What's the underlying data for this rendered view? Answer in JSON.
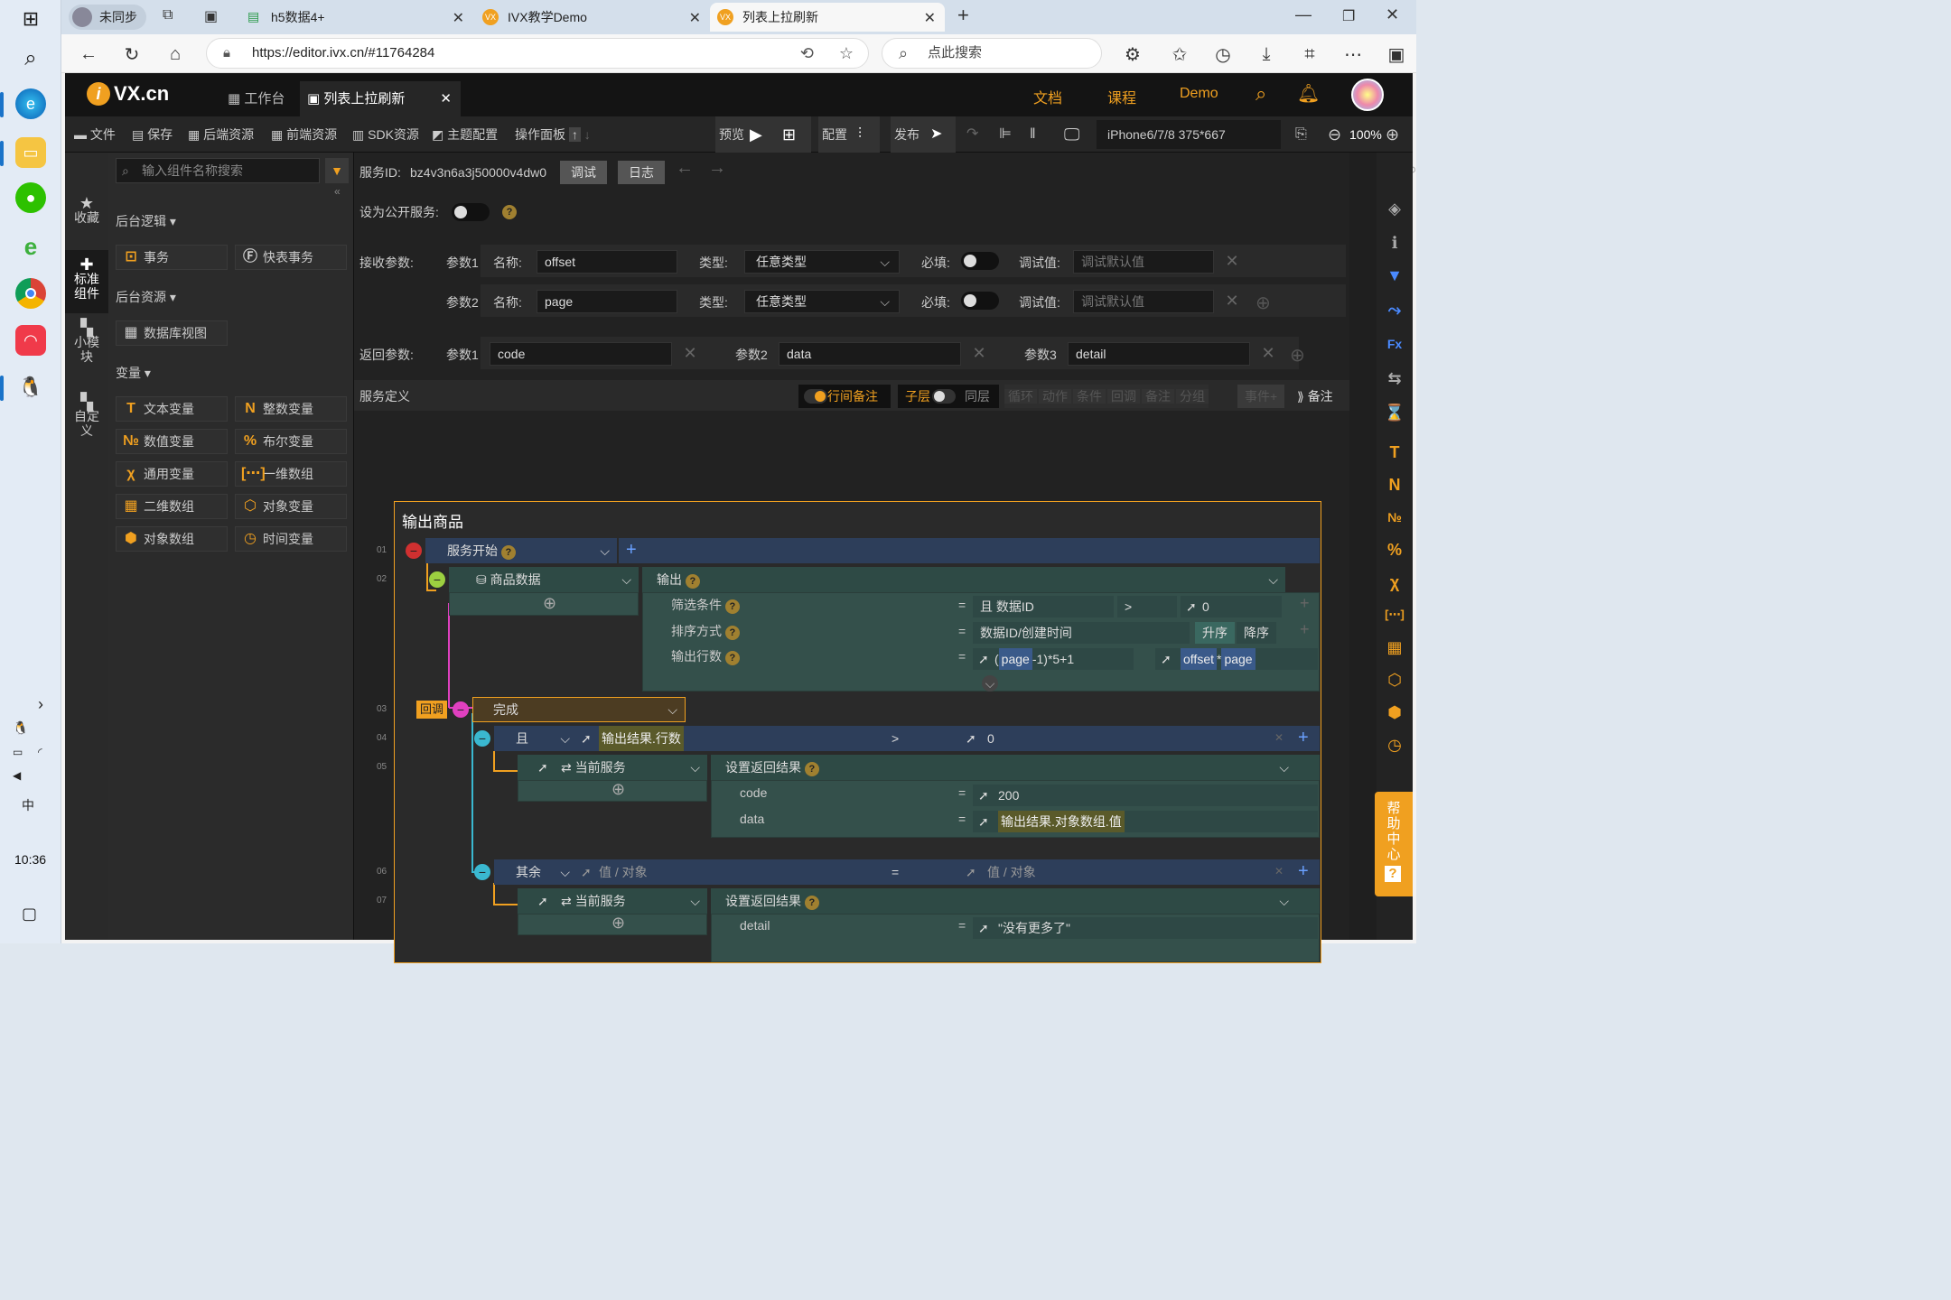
{
  "taskbar": {
    "clock": "10:36",
    "icons": [
      "windows-logo-icon",
      "search-icon",
      "edge-icon",
      "file-explorer-icon",
      "wechat-icon",
      "ie-icon",
      "chrome-icon",
      "app-icon",
      "qq-icon"
    ]
  },
  "browser": {
    "profile_label": "未同步",
    "tabs": [
      {
        "label": "h5数据4+"
      },
      {
        "label": "IVX教学Demo"
      },
      {
        "label": "列表上拉刷新"
      }
    ],
    "url": "https://editor.ivx.cn/#11764284",
    "search_placeholder": "点此搜索"
  },
  "app": {
    "logo": "VX.cn",
    "tabs": [
      {
        "label": "工作台"
      },
      {
        "label": "列表上拉刷新"
      }
    ],
    "header_links": [
      "文档",
      "课程",
      "Demo"
    ],
    "toolbar": {
      "file": "文件",
      "save": "保存",
      "backend_res": "后端资源",
      "frontend_res": "前端资源",
      "sdk_res": "SDK资源",
      "theme": "主题配置",
      "ops_panel": "操作面板",
      "preview": "预览",
      "config": "配置",
      "publish": "发布",
      "device": "iPhone6/7/8 375*667",
      "zoom": "100%"
    },
    "left_rail": [
      {
        "label": "收藏"
      },
      {
        "label": "标准组件"
      },
      {
        "label": "小模块"
      },
      {
        "label": "自定义"
      }
    ],
    "component_panel": {
      "search_placeholder": "输入组件名称搜索",
      "sections": [
        {
          "title": "后台逻辑",
          "items": [
            "事务",
            "快表事务"
          ]
        },
        {
          "title": "后台资源",
          "items": [
            "数据库视图"
          ]
        },
        {
          "title": "变量",
          "items": [
            "文本变量",
            "整数变量",
            "数值变量",
            "布尔变量",
            "通用变量",
            "一维数组",
            "二维数组",
            "对象变量",
            "对象数组",
            "时间变量"
          ]
        }
      ]
    },
    "service": {
      "id_label": "服务ID:",
      "id": "bz4v3n6a3j50000v4dw0",
      "debug_btn": "调试",
      "log_btn": "日志",
      "public_label": "设为公开服务:",
      "recv_label": "接收参数:",
      "params": [
        {
          "label": "参数1",
          "name_label": "名称:",
          "name": "offset",
          "type_label": "类型:",
          "type": "任意类型",
          "required_label": "必填:",
          "debug_label": "调试值:",
          "debug_placeholder": "调试默认值"
        },
        {
          "label": "参数2",
          "name_label": "名称:",
          "name": "page",
          "type_label": "类型:",
          "type": "任意类型",
          "required_label": "必填:",
          "debug_label": "调试值:",
          "debug_placeholder": "调试默认值"
        }
      ],
      "return_label": "返回参数:",
      "returns": [
        {
          "label": "参数1",
          "value": "code"
        },
        {
          "label": "参数2",
          "value": "data"
        },
        {
          "label": "参数3",
          "value": "detail"
        }
      ],
      "def_label": "服务定义",
      "def_toolbar": [
        "行间备注",
        "子层",
        "同层",
        "循环",
        "动作",
        "条件",
        "回调",
        "备注",
        "分组",
        "事件",
        "备注"
      ]
    },
    "logic": {
      "title": "输出商品",
      "rows": [
        {
          "num": "01",
          "text": "服务开始"
        },
        {
          "num": "02",
          "text": "商品数据",
          "action": "输出",
          "props": [
            {
              "label": "筛选条件",
              "v1": "且 数据ID",
              "op": ">",
              "v2": "0"
            },
            {
              "label": "排序方式",
              "v1": "数据ID/创建时间",
              "asc": "升序",
              "desc": "降序"
            },
            {
              "label": "输出行数",
              "v1a": "page",
              "v1b": "-1)*5+1",
              "v1pre": "(",
              "v2a": "offset",
              "v2b": "page"
            }
          ]
        },
        {
          "num": "03",
          "callback": "回调",
          "text": "完成"
        },
        {
          "num": "04",
          "cond": "且",
          "left": "输出结果.行数",
          "op": ">",
          "right": "0"
        },
        {
          "num": "05",
          "target": "当前服务",
          "action": "设置返回结果",
          "props": [
            {
              "label": "code",
              "value": "200"
            },
            {
              "label": "data",
              "value": "输出结果.对象数组.值"
            }
          ]
        },
        {
          "num": "06",
          "cond": "其余",
          "left": "值 / 对象",
          "op": "=",
          "right": "值 / 对象"
        },
        {
          "num": "07",
          "target": "当前服务",
          "action": "设置返回结果",
          "props": [
            {
              "label": "detail",
              "value": "\"没有更多了\""
            }
          ]
        }
      ]
    },
    "right_rail": {
      "help": "帮助中心"
    }
  },
  "colors": {
    "accent": "#f0a020",
    "bg": "#1f1f1f",
    "teal": "#34504b",
    "blue": "#2d3e5a"
  }
}
